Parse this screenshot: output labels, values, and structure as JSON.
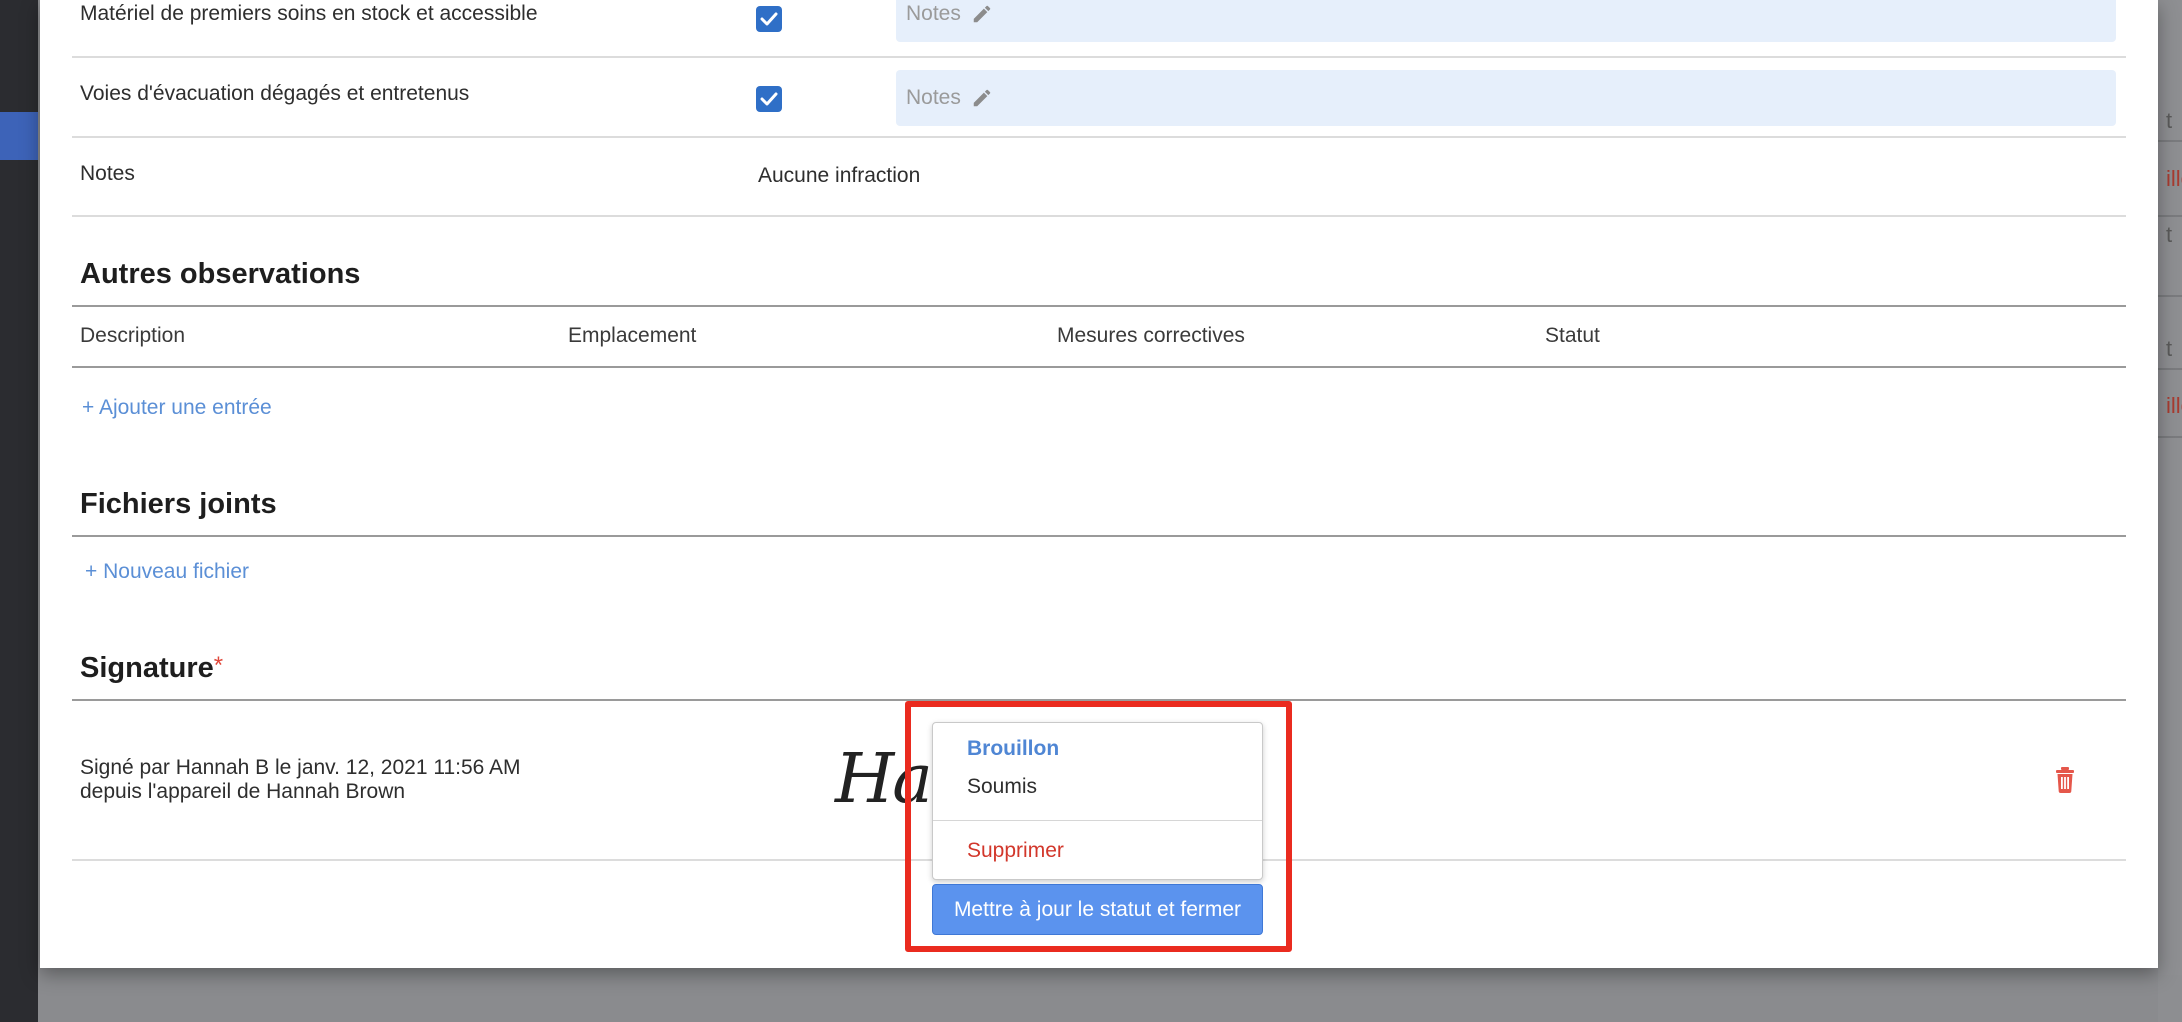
{
  "colors": {
    "accent": "#5b93ee",
    "link": "#5b8fd6",
    "danger": "#d2372b",
    "highlight": "#ea2b1f",
    "checkbox": "#2f6fc7",
    "notes_field_bg": "#e6effb"
  },
  "background": {
    "right_fragments": [
      "t",
      "illo",
      "t",
      "t",
      "illo"
    ]
  },
  "checklist": {
    "rows": [
      {
        "label": "Matériel de premiers soins en stock et accessible",
        "checked": true,
        "notes_placeholder": "Notes"
      },
      {
        "label": "Voies d'évacuation dégagés et entretenus",
        "checked": true,
        "notes_placeholder": "Notes"
      }
    ],
    "notes_row": {
      "label": "Notes",
      "value": "Aucune infraction"
    }
  },
  "other_observations": {
    "title": "Autres observations",
    "columns": [
      "Description",
      "Emplacement",
      "Mesures correctives",
      "Statut"
    ],
    "add_entry_label": "+ Ajouter une entrée"
  },
  "attachments": {
    "title": "Fichiers joints",
    "new_file_label": "+ Nouveau fichier"
  },
  "signature": {
    "title": "Signature",
    "required_mark": "*",
    "signed_by_line1": "Signé par Hannah B le janv. 12, 2021 11:56 AM",
    "signed_by_line2": "depuis l'appareil de Hannah Brown",
    "signature_text": "Han",
    "delete_icon": "trash-icon"
  },
  "status_menu": {
    "options": [
      {
        "label": "Brouillon",
        "selected": true
      },
      {
        "label": "Soumis",
        "selected": false
      }
    ],
    "delete_label": "Supprimer",
    "submit_button_label": "Mettre à jour le statut et fermer"
  }
}
